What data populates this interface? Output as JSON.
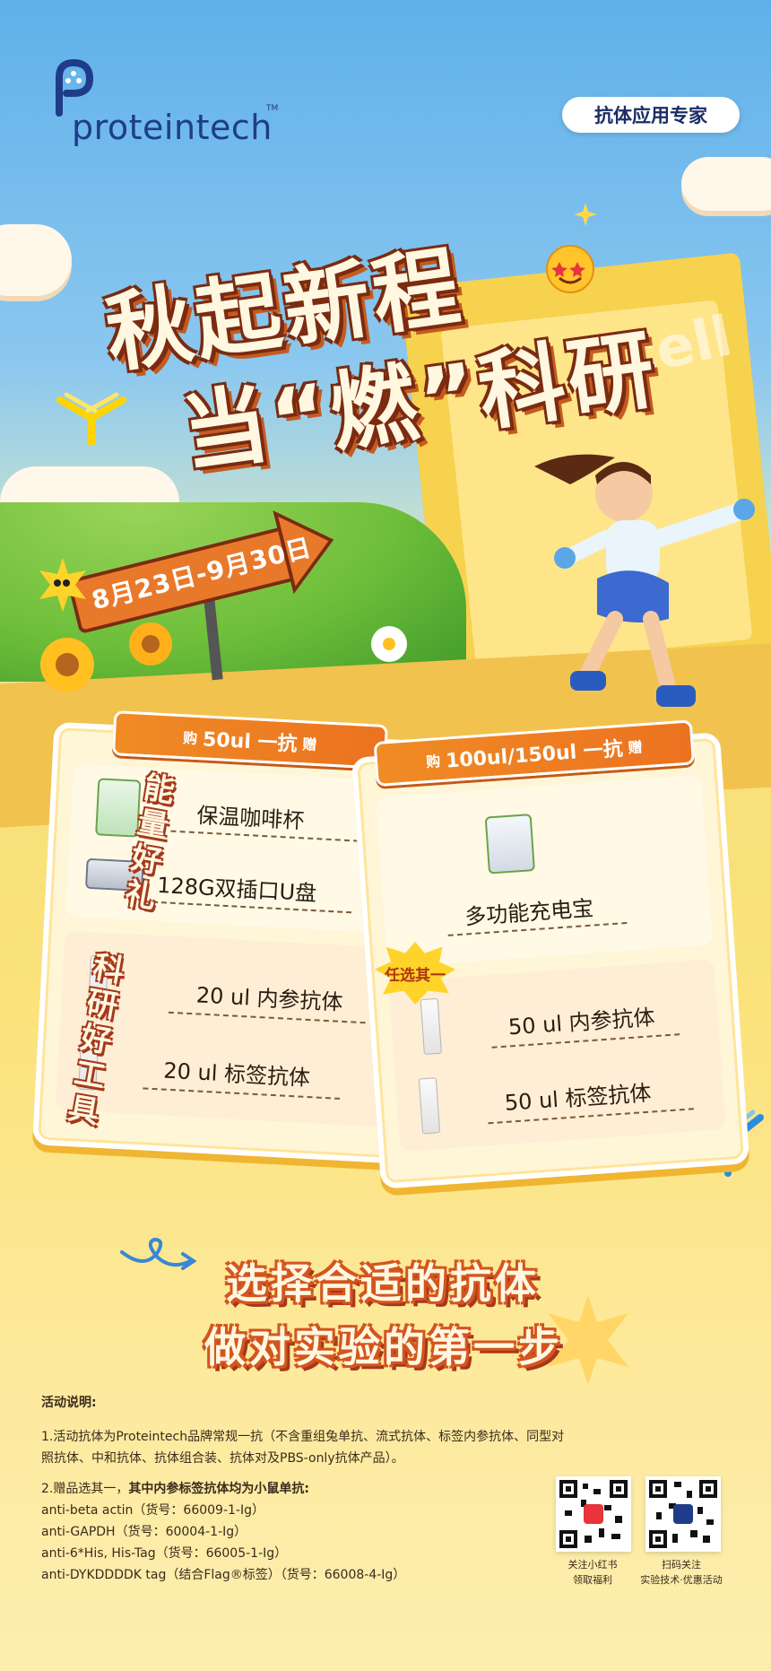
{
  "brand": {
    "name": "proteintech",
    "tm": "TM"
  },
  "tagline": "抗体应用专家",
  "headline": {
    "line1": "秋起新程",
    "line2": "当“燃”科研"
  },
  "background_text": "cell",
  "date_range": "8月23日-9月30日",
  "cards": {
    "left": {
      "tab": {
        "prefix": "购",
        "main": "50ul 一抗",
        "suffix": "赠"
      },
      "gifts": [
        "保温咖啡杯",
        "128G双插口U盘"
      ],
      "tools": [
        "20 ul 内参抗体",
        "20 ul 标签抗体"
      ]
    },
    "right": {
      "tab": {
        "prefix": "购",
        "main": "100ul/150ul 一抗",
        "suffix": "赠"
      },
      "gifts": [
        "多功能充电宝"
      ],
      "tools": [
        "50 ul 内参抗体",
        "50 ul 标签抗体"
      ]
    }
  },
  "labels": {
    "gifts": "能量好礼",
    "tools": "科研好工具",
    "choose_one": "任选其一"
  },
  "slogan": {
    "line1": "选择合适的抗体",
    "line2": "做对实验的第一步"
  },
  "notes": {
    "title": "活动说明:",
    "item1": "1.活动抗体为Proteintech品牌常规一抗（不含重组兔单抗、流式抗体、标签内参抗体、同型对照抗体、中和抗体、抗体组合装、抗体对及PBS-only抗体产品）。",
    "item2_prefix": "2.赠品选其一，",
    "item2_bold": "其中内参标签抗体均为小鼠单抗:",
    "antibodies": [
      "anti-beta actin（货号：66009-1-Ig）",
      "anti-GAPDH（货号：60004-1-Ig）",
      "anti-6*His, His-Tag（货号：66005-1-Ig）",
      "anti-DYKDDDDK tag（结合Flag®标签）（货号：66008-4-Ig）"
    ]
  },
  "qr": [
    {
      "caption1": "关注小红书",
      "caption2": "领取福利",
      "logo_color": "#e8343a"
    },
    {
      "caption1": "扫码关注",
      "caption2": "实验技术·优惠活动",
      "logo_color": "#1f3c88"
    }
  ],
  "colors": {
    "brand_blue": "#1f3c88",
    "orange": "#ec7220",
    "brown_outline": "#7a2b11",
    "yellow": "#fbe27a"
  }
}
